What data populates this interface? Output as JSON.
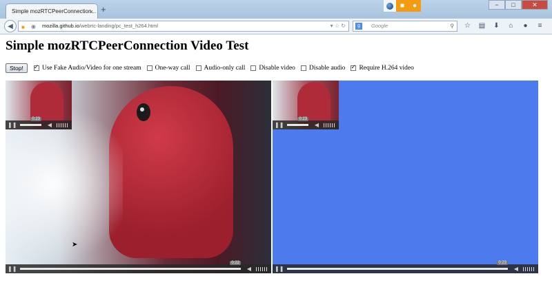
{
  "browser": {
    "tab_title": "Simple mozRTCPeerConnection...",
    "tab_close": "×",
    "new_tab": "+",
    "url_host": "mozilla.github.io",
    "url_path": "/webrtc-landing/pc_test_h264.html",
    "search_placeholder": "Google",
    "indicators": [
      "globe-icon",
      "camera-icon",
      "microphone-icon"
    ],
    "window_controls": [
      "−",
      "□",
      "✕"
    ]
  },
  "page": {
    "title": "Simple mozRTCPeerConnection Video Test",
    "stop_button": "Stop!",
    "options": [
      {
        "label": "Use Fake Audio/Video for one stream",
        "checked": true
      },
      {
        "label": "One-way call",
        "checked": false
      },
      {
        "label": "Audio-only call",
        "checked": false
      },
      {
        "label": "Disable video",
        "checked": false
      },
      {
        "label": "Disable audio",
        "checked": false
      },
      {
        "label": "Require H.264 video",
        "checked": true
      }
    ]
  },
  "videos": {
    "left_pip_time": "0:23",
    "left_main_time": "0:22",
    "right_pip_time": "0:23",
    "right_main_time": "0:23"
  }
}
